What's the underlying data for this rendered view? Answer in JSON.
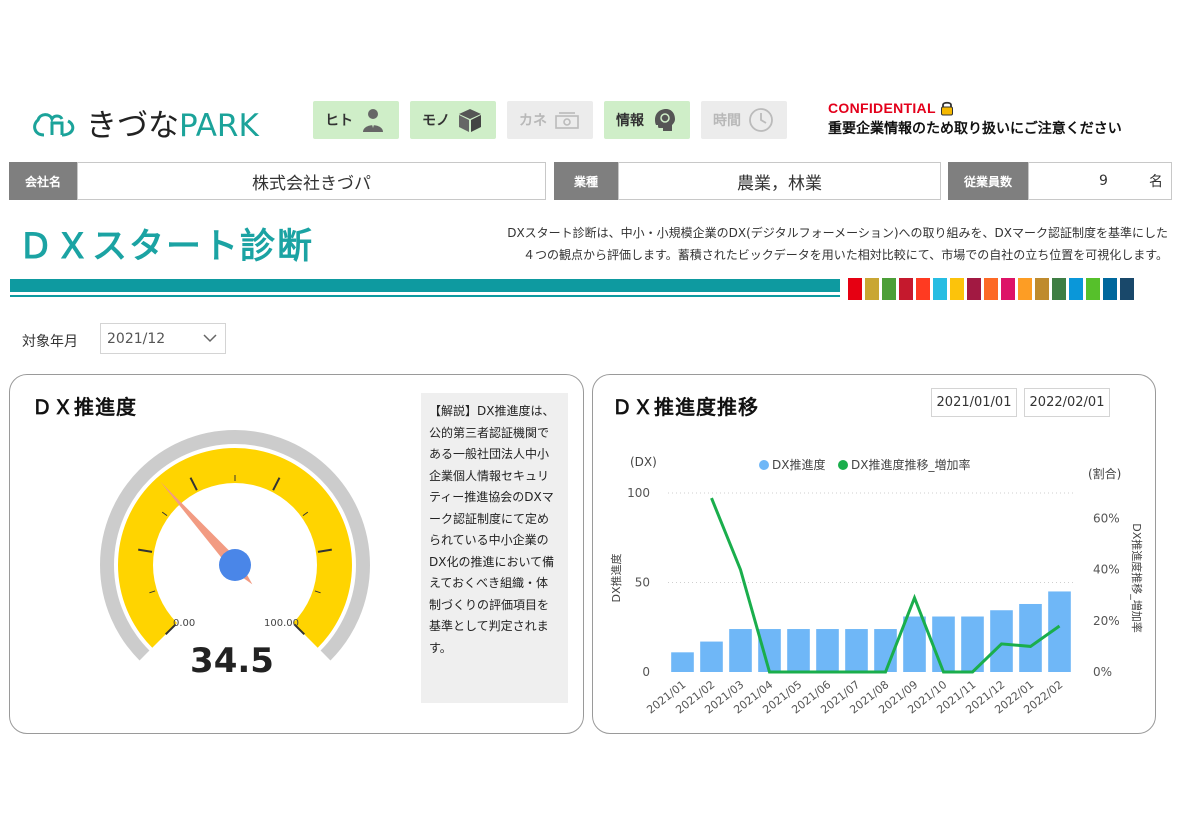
{
  "header": {
    "logo_text_main": "きづな",
    "logo_text_accent": "PARK",
    "nav": [
      {
        "label": "ヒト",
        "icon": "person-icon",
        "active": true
      },
      {
        "label": "モノ",
        "icon": "box-icon",
        "active": true
      },
      {
        "label": "カネ",
        "icon": "money-icon",
        "active": false
      },
      {
        "label": "情報",
        "icon": "brain-icon",
        "active": true
      },
      {
        "label": "時間",
        "icon": "clock-icon",
        "active": false
      }
    ],
    "confidential_title": "CONFIDENTIAL",
    "confidential_note": "重要企業情報のため取り扱いにご注意ください"
  },
  "company": {
    "name_label": "会社名",
    "name_value": "株式会社きづパ",
    "industry_label": "業種",
    "industry_value": "農業，林業",
    "employees_label": "従業員数",
    "employees_value": "9",
    "employees_unit": "名"
  },
  "page": {
    "title": "ＤＸスタート診断",
    "description_line1": "DXスタート診断は、中小・小規模企業のDX(デジタルフォーメーション)への取り組みを、DXマーク認証制度を基準にした",
    "description_line2": "４つの観点から評価します。蓄積されたビックデータを用いた相対比較にて、市場での自社の立ち位置を可視化します。",
    "swatch_colors": [
      "#e60012",
      "#c9a633",
      "#4c9f38",
      "#c5192d",
      "#ff3a21",
      "#26bde2",
      "#fcc30b",
      "#a21942",
      "#fd6925",
      "#dd1367",
      "#fd9d24",
      "#bf8b2e",
      "#3f7e44",
      "#0a97d9",
      "#56c02b",
      "#00689d",
      "#19486a"
    ]
  },
  "filter": {
    "label": "対象年月",
    "value": "2021/12"
  },
  "gauge_card": {
    "title": "ＤＸ推進度",
    "value": 34.5,
    "value_text": "34.5",
    "min_label": "0.00",
    "max_label": "100.00",
    "note": "【解説】DX推進度は、公的第三者認証機関である一般社団法人中小企業個人情報セキュリティー推進協会のDXマーク認証制度にて定められている中小企業のDX化の推進において備えておくべき組織・体制づくりの評価項目を基準として判定されます。",
    "colors": {
      "fill": "#ffd400",
      "ring": "#cccccc",
      "needle": "#f29b82",
      "hub": "#4a86e8"
    }
  },
  "trend_card": {
    "title": "ＤＸ推進度推移",
    "date_from": "2021/01/01",
    "date_to": "2022/02/01"
  },
  "chart_data": {
    "type": "bar",
    "categories": [
      "2021/01",
      "2021/02",
      "2021/03",
      "2021/04",
      "2021/05",
      "2021/06",
      "2021/07",
      "2021/08",
      "2021/09",
      "2021/10",
      "2021/11",
      "2021/12",
      "2022/01",
      "2022/02"
    ],
    "series": [
      {
        "name": "DX推進度",
        "type": "bar",
        "axis": "left",
        "color": "#6fb7f7",
        "values": [
          11,
          17,
          24,
          24,
          24,
          24,
          24,
          24,
          31,
          31,
          31,
          34.5,
          38,
          45
        ]
      },
      {
        "name": "DX推進度推移_増加率",
        "type": "line",
        "axis": "right",
        "color": "#1aae4c",
        "values": [
          null,
          68,
          40,
          0,
          0,
          0,
          0,
          0,
          29,
          0,
          0,
          11,
          10,
          18
        ]
      }
    ],
    "left_axis": {
      "title": "DX推進度",
      "unit": "(DX)",
      "ticks": [
        "0",
        "50",
        "100"
      ],
      "range": [
        0,
        100
      ]
    },
    "right_axis": {
      "title": "DX推進度推移_増加率",
      "unit": "(割合)",
      "ticks": [
        "0%",
        "20%",
        "40%",
        "60%"
      ],
      "range": [
        0,
        70
      ]
    },
    "legend_position": "top"
  }
}
